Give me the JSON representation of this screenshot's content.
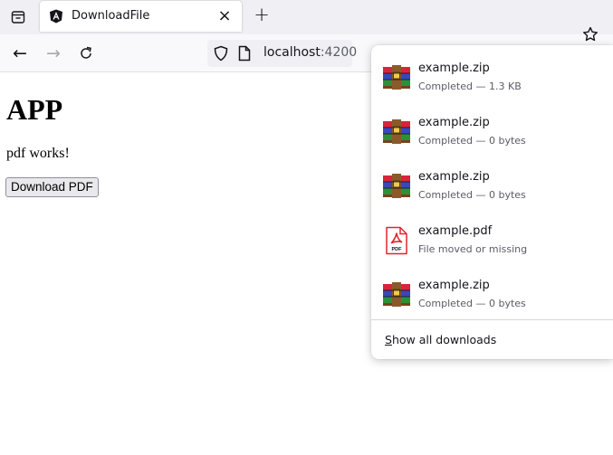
{
  "browser": {
    "tab": {
      "title": "DownloadFile",
      "close_glyph": "×",
      "favicon": "angular-logo-icon"
    },
    "new_tab_glyph": "+",
    "nav": {
      "back_glyph": "←",
      "forward_glyph": "→"
    },
    "url": {
      "host": "localhost",
      "port": ":4200"
    }
  },
  "page": {
    "heading": "APP",
    "text": "pdf works!",
    "button_label": "Download PDF"
  },
  "downloads": {
    "items": [
      {
        "name": "example.zip",
        "status": "Completed — 1.3 KB",
        "icon": "zip-archive-icon"
      },
      {
        "name": "example.zip",
        "status": "Completed — 0 bytes",
        "icon": "zip-archive-icon"
      },
      {
        "name": "example.zip",
        "status": "Completed — 0 bytes",
        "icon": "zip-archive-icon"
      },
      {
        "name": "example.pdf",
        "status": "File moved or missing",
        "icon": "pdf-file-icon"
      },
      {
        "name": "example.zip",
        "status": "Completed — 0 bytes",
        "icon": "zip-archive-icon"
      }
    ],
    "show_all": "Show all downloads"
  },
  "colors": {
    "accent": "#15141a",
    "pdf_red": "#e0272c",
    "panel_bg": "#ffffff",
    "toolbar_bg": "#f9f9fb"
  }
}
